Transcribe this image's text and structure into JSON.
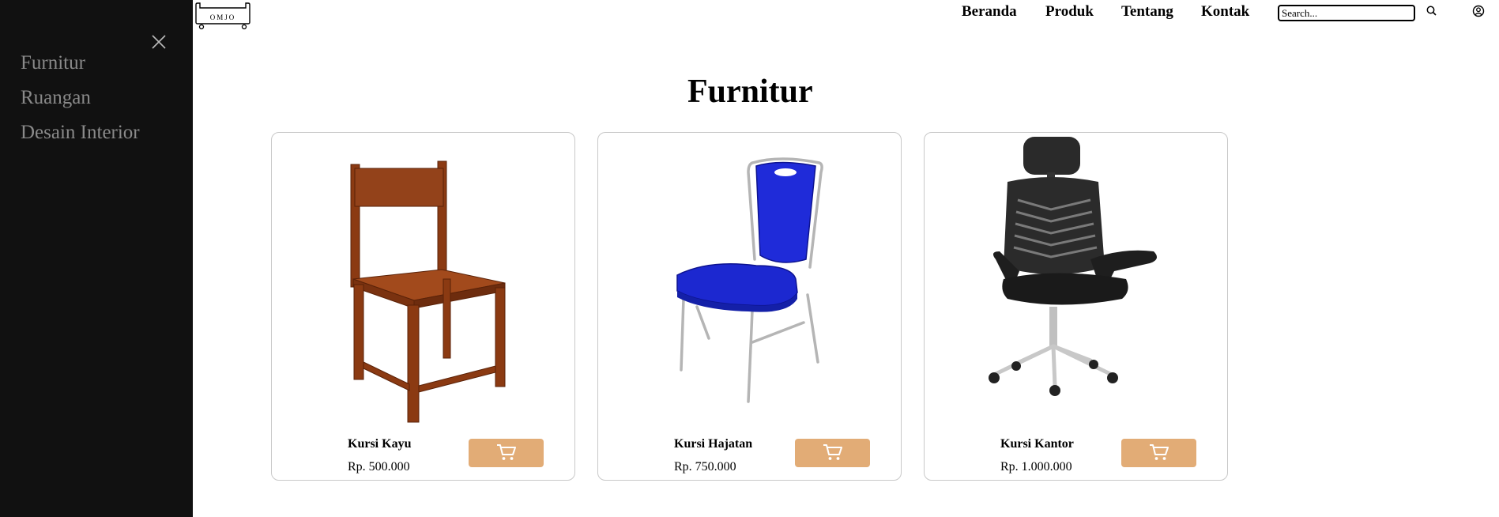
{
  "brand": {
    "logo_text": "OMJO"
  },
  "sidebar": {
    "items": [
      {
        "label": "Furnitur"
      },
      {
        "label": "Ruangan"
      },
      {
        "label": "Desain Interior"
      }
    ]
  },
  "header": {
    "nav": [
      {
        "label": "Beranda"
      },
      {
        "label": "Produk"
      },
      {
        "label": "Tentang"
      },
      {
        "label": "Kontak"
      }
    ],
    "search": {
      "placeholder": "Search..."
    },
    "icons": [
      "search-icon",
      "user-icon"
    ]
  },
  "main": {
    "title": "Furnitur",
    "products": [
      {
        "name": "Kursi Kayu",
        "price": "Rp. 500.000",
        "image": "wooden-chair"
      },
      {
        "name": "Kursi Hajatan",
        "price": "Rp. 750.000",
        "image": "blue-banquet-chair"
      },
      {
        "name": "Kursi Kantor",
        "price": "Rp. 1.000.000",
        "image": "office-chair"
      }
    ],
    "cart_icon": "cart-icon"
  },
  "colors": {
    "sidebar_bg": "#111111",
    "sidebar_text": "#8a8a8a",
    "cart_button": "#e2ac76"
  }
}
